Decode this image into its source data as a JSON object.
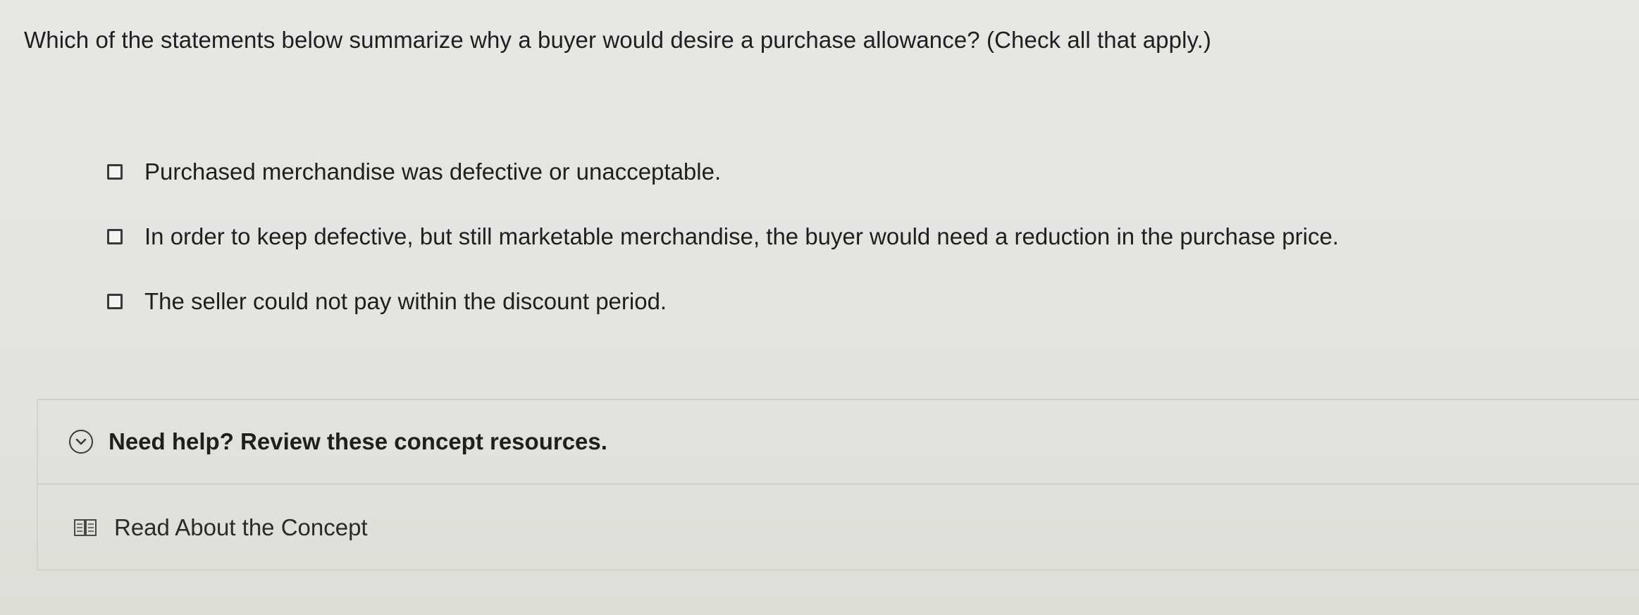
{
  "question": {
    "text": "Which of the statements below summarize why a buyer would desire a purchase allowance? (Check all that apply.)"
  },
  "options": [
    {
      "label": "Purchased merchandise was defective or unacceptable.",
      "checked": false
    },
    {
      "label": "In order to keep defective, but still marketable merchandise, the buyer would need a reduction in the purchase price.",
      "checked": false
    },
    {
      "label": "The seller could not pay within the discount period.",
      "checked": false
    }
  ],
  "help": {
    "title": "Need help? Review these concept resources.",
    "toggle_icon": "chevron-down-circle-icon",
    "resources": [
      {
        "label": "Read About the Concept",
        "icon": "book-icon"
      }
    ]
  }
}
